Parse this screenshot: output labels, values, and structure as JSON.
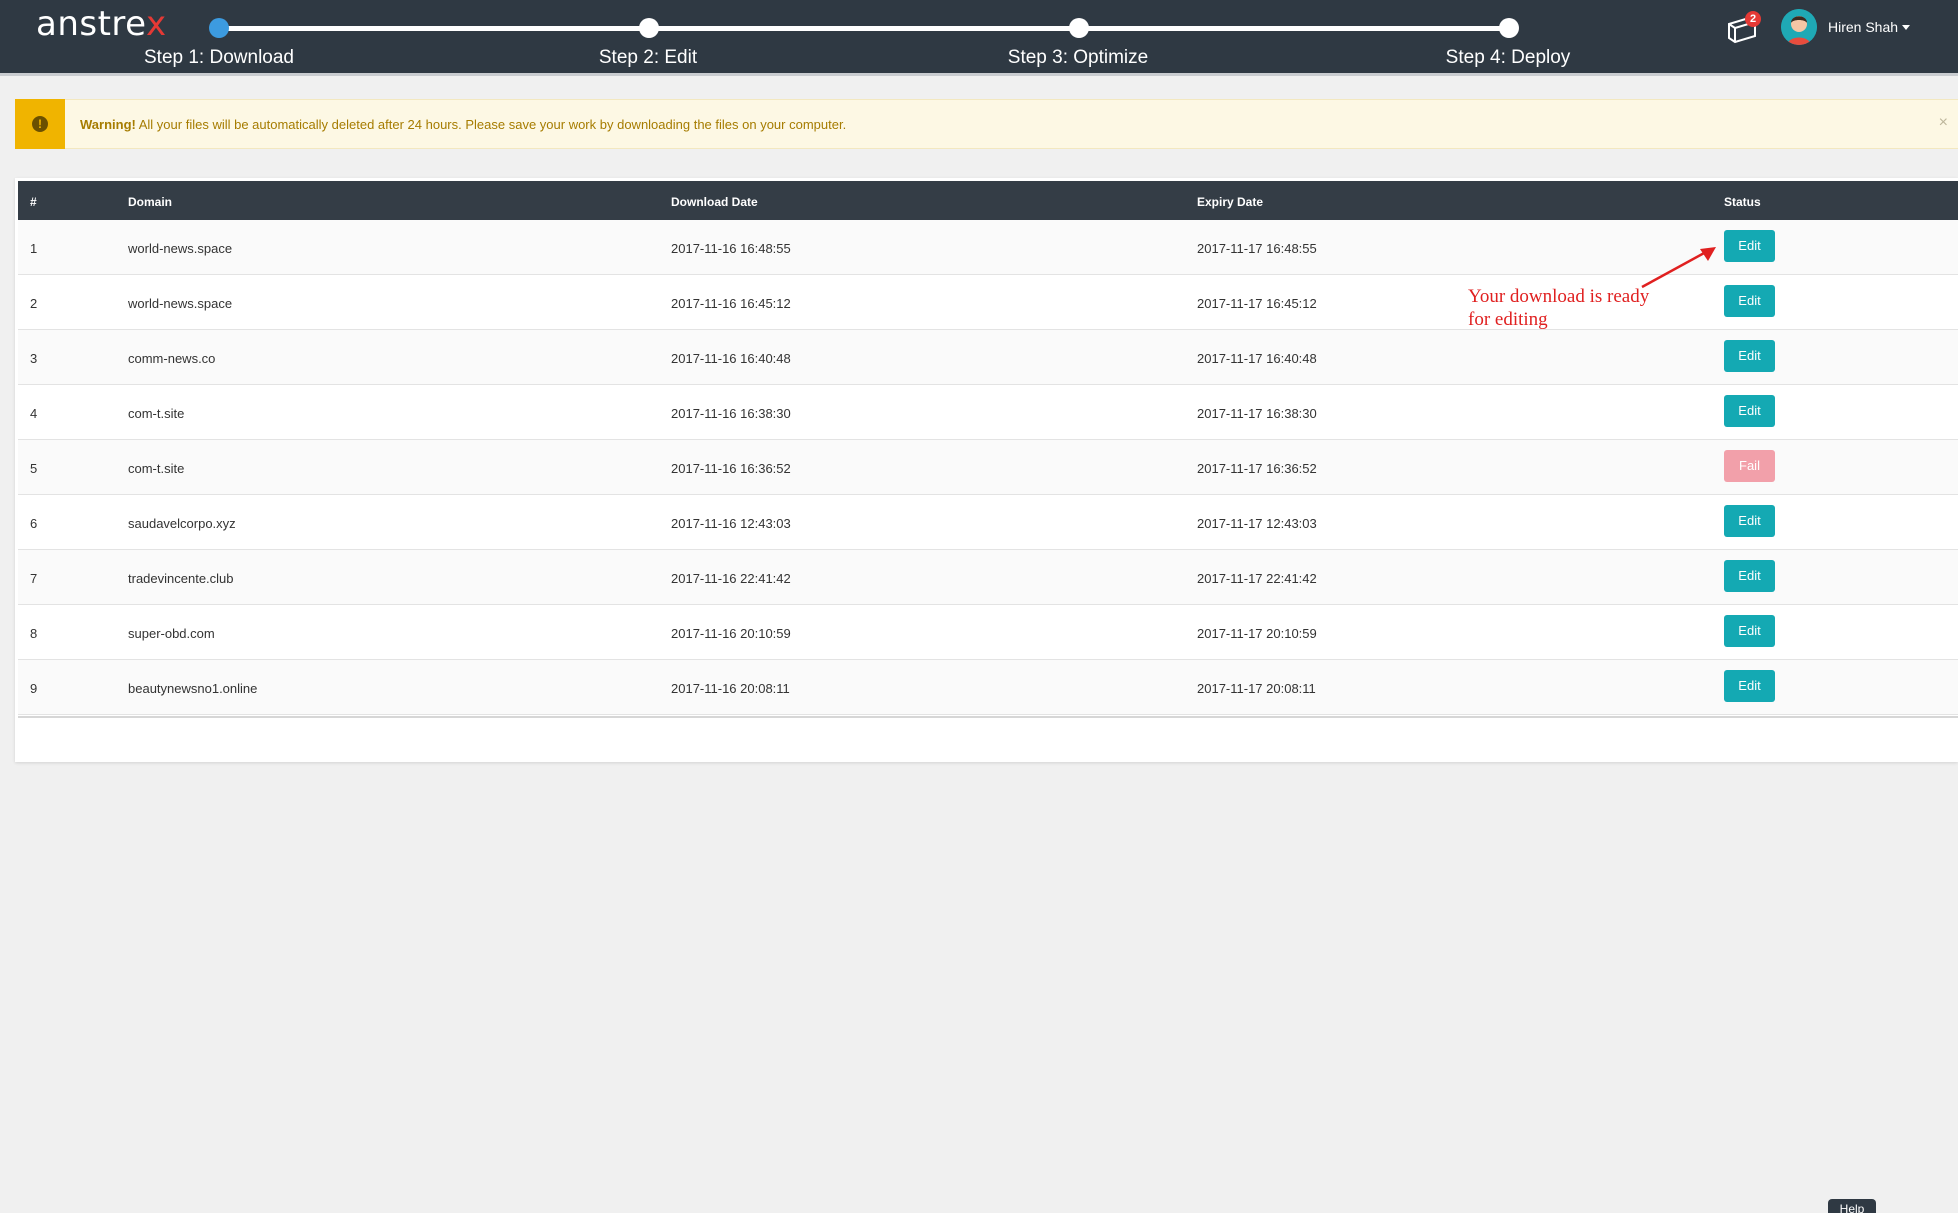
{
  "header": {
    "logo_text": "anstre",
    "logo_accent": "x",
    "steps": [
      {
        "label": "Step 1: Download",
        "active": true
      },
      {
        "label": "Step 2: Edit",
        "active": false
      },
      {
        "label": "Step 3: Optimize",
        "active": false
      },
      {
        "label": "Step 4: Deploy",
        "active": false
      }
    ],
    "notification_count": "2",
    "user_name": "Hiren Shah"
  },
  "warning": {
    "title": "Warning!",
    "message": "All your files will be automatically deleted after 24 hours. Please save your work by downloading the files on your computer.",
    "close": "×"
  },
  "table": {
    "columns": [
      "#",
      "Domain",
      "Download Date",
      "Expiry Date",
      "Status"
    ],
    "rows": [
      {
        "num": "1",
        "domain": "world-news.space",
        "download": "2017-11-16 16:48:55",
        "expiry": "2017-11-17 16:48:55",
        "status": "Edit"
      },
      {
        "num": "2",
        "domain": "world-news.space",
        "download": "2017-11-16 16:45:12",
        "expiry": "2017-11-17 16:45:12",
        "status": "Edit"
      },
      {
        "num": "3",
        "domain": "comm-news.co",
        "download": "2017-11-16 16:40:48",
        "expiry": "2017-11-17 16:40:48",
        "status": "Edit"
      },
      {
        "num": "4",
        "domain": "com-t.site",
        "download": "2017-11-16 16:38:30",
        "expiry": "2017-11-17 16:38:30",
        "status": "Edit"
      },
      {
        "num": "5",
        "domain": "com-t.site",
        "download": "2017-11-16 16:36:52",
        "expiry": "2017-11-17 16:36:52",
        "status": "Fail"
      },
      {
        "num": "6",
        "domain": "saudavelcorpo.xyz",
        "download": "2017-11-16 12:43:03",
        "expiry": "2017-11-17 12:43:03",
        "status": "Edit"
      },
      {
        "num": "7",
        "domain": "tradevincente.club",
        "download": "2017-11-16 22:41:42",
        "expiry": "2017-11-17 22:41:42",
        "status": "Edit"
      },
      {
        "num": "8",
        "domain": "super-obd.com",
        "download": "2017-11-16 20:10:59",
        "expiry": "2017-11-17 20:10:59",
        "status": "Edit"
      },
      {
        "num": "9",
        "domain": "beautynewsno1.online",
        "download": "2017-11-16 20:08:11",
        "expiry": "2017-11-17 20:08:11",
        "status": "Edit"
      }
    ]
  },
  "annotation": {
    "line1": "Your download is ready",
    "line2": "for editing"
  },
  "help": {
    "label": "Help"
  },
  "colors": {
    "topbar": "#2f3943",
    "accent_teal": "#14a9b3",
    "fail_pink": "#f2a0aa",
    "warning_yellow": "#f0b400",
    "annotation_red": "#e02020"
  }
}
